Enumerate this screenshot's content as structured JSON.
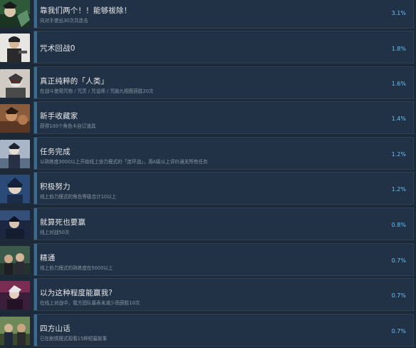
{
  "achievements": [
    {
      "title": "靠我们两个！！能够祓除！",
      "desc": "向对手使出30次共连击",
      "pct": "3.1%",
      "icon": "achievement-thumbnail"
    },
    {
      "title": "咒术回战0",
      "desc": "",
      "pct": "1.8%",
      "icon": "achievement-thumbnail"
    },
    {
      "title": "真正纯粹的「人类」",
      "desc": "在战斗使用咒物 / 咒灵 / 咒诅师 / 咒胎九相图获胜20次",
      "pct": "1.6%",
      "icon": "achievement-thumbnail"
    },
    {
      "title": "新手收藏家",
      "desc": "获得100个角色卡自订道具",
      "pct": "1.4%",
      "icon": "achievement-thumbnail"
    },
    {
      "title": "任务完成",
      "desc": "以熟练度3000以上开始线上协力模式的「连环战」，用A级以上评价通关所有任务",
      "pct": "1.2%",
      "icon": "achievement-thumbnail"
    },
    {
      "title": "积极努力",
      "desc": "线上协力模式的角色等级合计10以上",
      "pct": "1.2%",
      "icon": "achievement-thumbnail"
    },
    {
      "title": "就算死也要赢",
      "desc": "线上对战50次",
      "pct": "0.8%",
      "icon": "achievement-thumbnail"
    },
    {
      "title": "精通",
      "desc": "线上协力模式的熟练度在5000以上",
      "pct": "0.7%",
      "icon": "achievement-thumbnail"
    },
    {
      "title": "以为这种程度能赢我?",
      "desc": "在线上对战中，我方团队最表未减少而获胜10次",
      "pct": "0.7%",
      "icon": "achievement-thumbnail"
    },
    {
      "title": "四方山话",
      "desc": "已在剧情模式观看15种短篇故事",
      "pct": "0.7%",
      "icon": "achievement-thumbnail"
    }
  ]
}
